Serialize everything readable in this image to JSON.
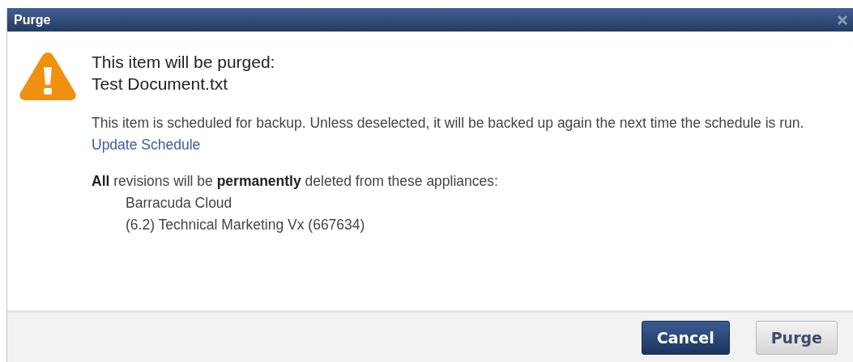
{
  "dialog": {
    "title": "Purge",
    "heading": [
      "This item will be purged:",
      "Test Document.txt"
    ],
    "schedule_note": "This item is scheduled for backup. Unless deselected, it will be backed up again the next time the schedule is run.",
    "schedule_link": "Update Schedule",
    "deletion_note": "**All** revisions will be **permanently** deleted from these appliances:",
    "appliances": [
      "Barracuda Cloud",
      "(6.2) Technical Marketing Vx (667634)"
    ],
    "buttons": [
      {
        "label": "Cancel",
        "kind": "primary"
      },
      {
        "label": "Purge",
        "kind": "secondary"
      }
    ]
  }
}
